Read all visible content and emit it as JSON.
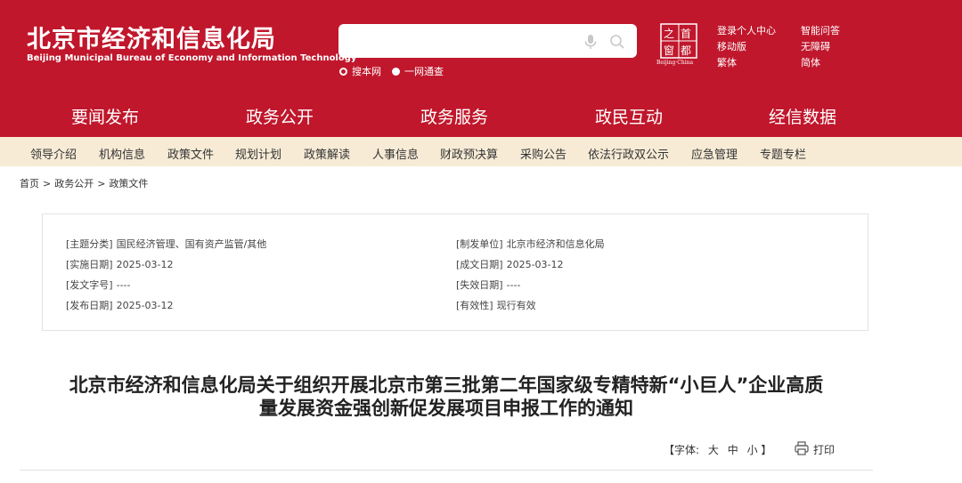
{
  "header": {
    "logo_cn": "北京市经济和信息化局",
    "logo_en": "Beijing Municipal Bureau of Economy and Information Technology",
    "search": {
      "value": "",
      "placeholder": ""
    },
    "scope_options": [
      {
        "label": "搜本网",
        "selected": false
      },
      {
        "label": "一网通查",
        "selected": true
      }
    ],
    "city_logo": {
      "chars": [
        "首",
        "都",
        "之",
        "窗"
      ],
      "caption": "Beijing·China"
    },
    "links": [
      "登录个人中心",
      "移动版",
      "繁体",
      "智能问答",
      "无障碍",
      "简体"
    ]
  },
  "main_nav": [
    "要闻发布",
    "政务公开",
    "政务服务",
    "政民互动",
    "经信数据"
  ],
  "sub_nav": [
    "领导介绍",
    "机构信息",
    "政策文件",
    "规划计划",
    "政策解读",
    "人事信息",
    "财政预决算",
    "采购公告",
    "依法行政双公示",
    "应急管理",
    "专题专栏"
  ],
  "breadcrumb": [
    "首页",
    "政务公开",
    "政策文件"
  ],
  "breadcrumb_sep": ">",
  "metadata": {
    "left": [
      {
        "label": "[主题分类]",
        "value": "国民经济管理、国有资产监管/其他"
      },
      {
        "label": "[实施日期]",
        "value": "2025-03-12"
      },
      {
        "label": "[发文字号]",
        "value": "----"
      },
      {
        "label": "[发布日期]",
        "value": "2025-03-12"
      }
    ],
    "right": [
      {
        "label": "[制发单位]",
        "value": "北京市经济和信息化局"
      },
      {
        "label": "[成文日期]",
        "value": "2025-03-12"
      },
      {
        "label": "[失效日期]",
        "value": "----"
      },
      {
        "label": "[有效性]",
        "value": "现行有效"
      }
    ]
  },
  "article": {
    "title_line1": "北京市经济和信息化局关于组织开展北京市第三批第二年国家级专精特新“小巨人”企业高质",
    "title_line2": "量发展资金强创新促发展项目申报工作的通知"
  },
  "tools": {
    "font_prefix": "【字体:",
    "font_sizes": [
      "大",
      "中",
      "小"
    ],
    "font_suffix": "】",
    "print_label": "打印"
  },
  "colors": {
    "brand_red": "#c0172c",
    "subnav_bg": "#f7ebd6",
    "white": "#ffffff"
  },
  "icons": [
    "microphone-icon",
    "search-icon",
    "print-icon",
    "radio-icon"
  ]
}
